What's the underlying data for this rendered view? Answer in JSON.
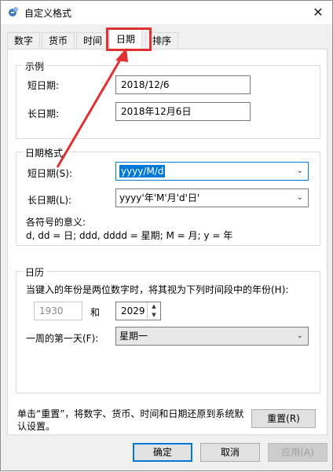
{
  "window": {
    "title": "自定义格式",
    "close_glyph": "✕"
  },
  "tabs": [
    {
      "label": "数字"
    },
    {
      "label": "货币"
    },
    {
      "label": "时间"
    },
    {
      "label": "日期"
    },
    {
      "label": "排序"
    }
  ],
  "active_tab": "日期",
  "example": {
    "group_title": "示例",
    "short_label": "短日期:",
    "short_value": "2018/12/6",
    "long_label": "长日期:",
    "long_value": "2018年12月6日"
  },
  "date_format": {
    "group_title": "日期格式",
    "short_label": "短日期(S):",
    "short_value": "yyyy/M/d",
    "long_label": "长日期(L):",
    "long_value": "yyyy'年'M'月'd'日'",
    "legend_title": "各符号的意义:",
    "legend_text": "d, dd = 日;  ddd, dddd = 星期;  M = 月;  y = 年"
  },
  "calendar": {
    "group_title": "日历",
    "two_digit_text": "当键入的年份是两位数字时，将其视为下列时间段中的年份(H):",
    "year_from": "1930",
    "and_label": "和",
    "year_to": "2029",
    "first_day_label": "一周的第一天(F):",
    "first_day_value": "星期一"
  },
  "footer": {
    "reset_text": "单击“重置”，将数字、货币、时间和日期还原到系统默认设置。",
    "reset_button": "重置(R)",
    "ok_button": "确定",
    "cancel_button": "取消",
    "apply_button": "应用(A)"
  },
  "colors": {
    "annotation": "#e03030",
    "accent": "#0078d7"
  }
}
